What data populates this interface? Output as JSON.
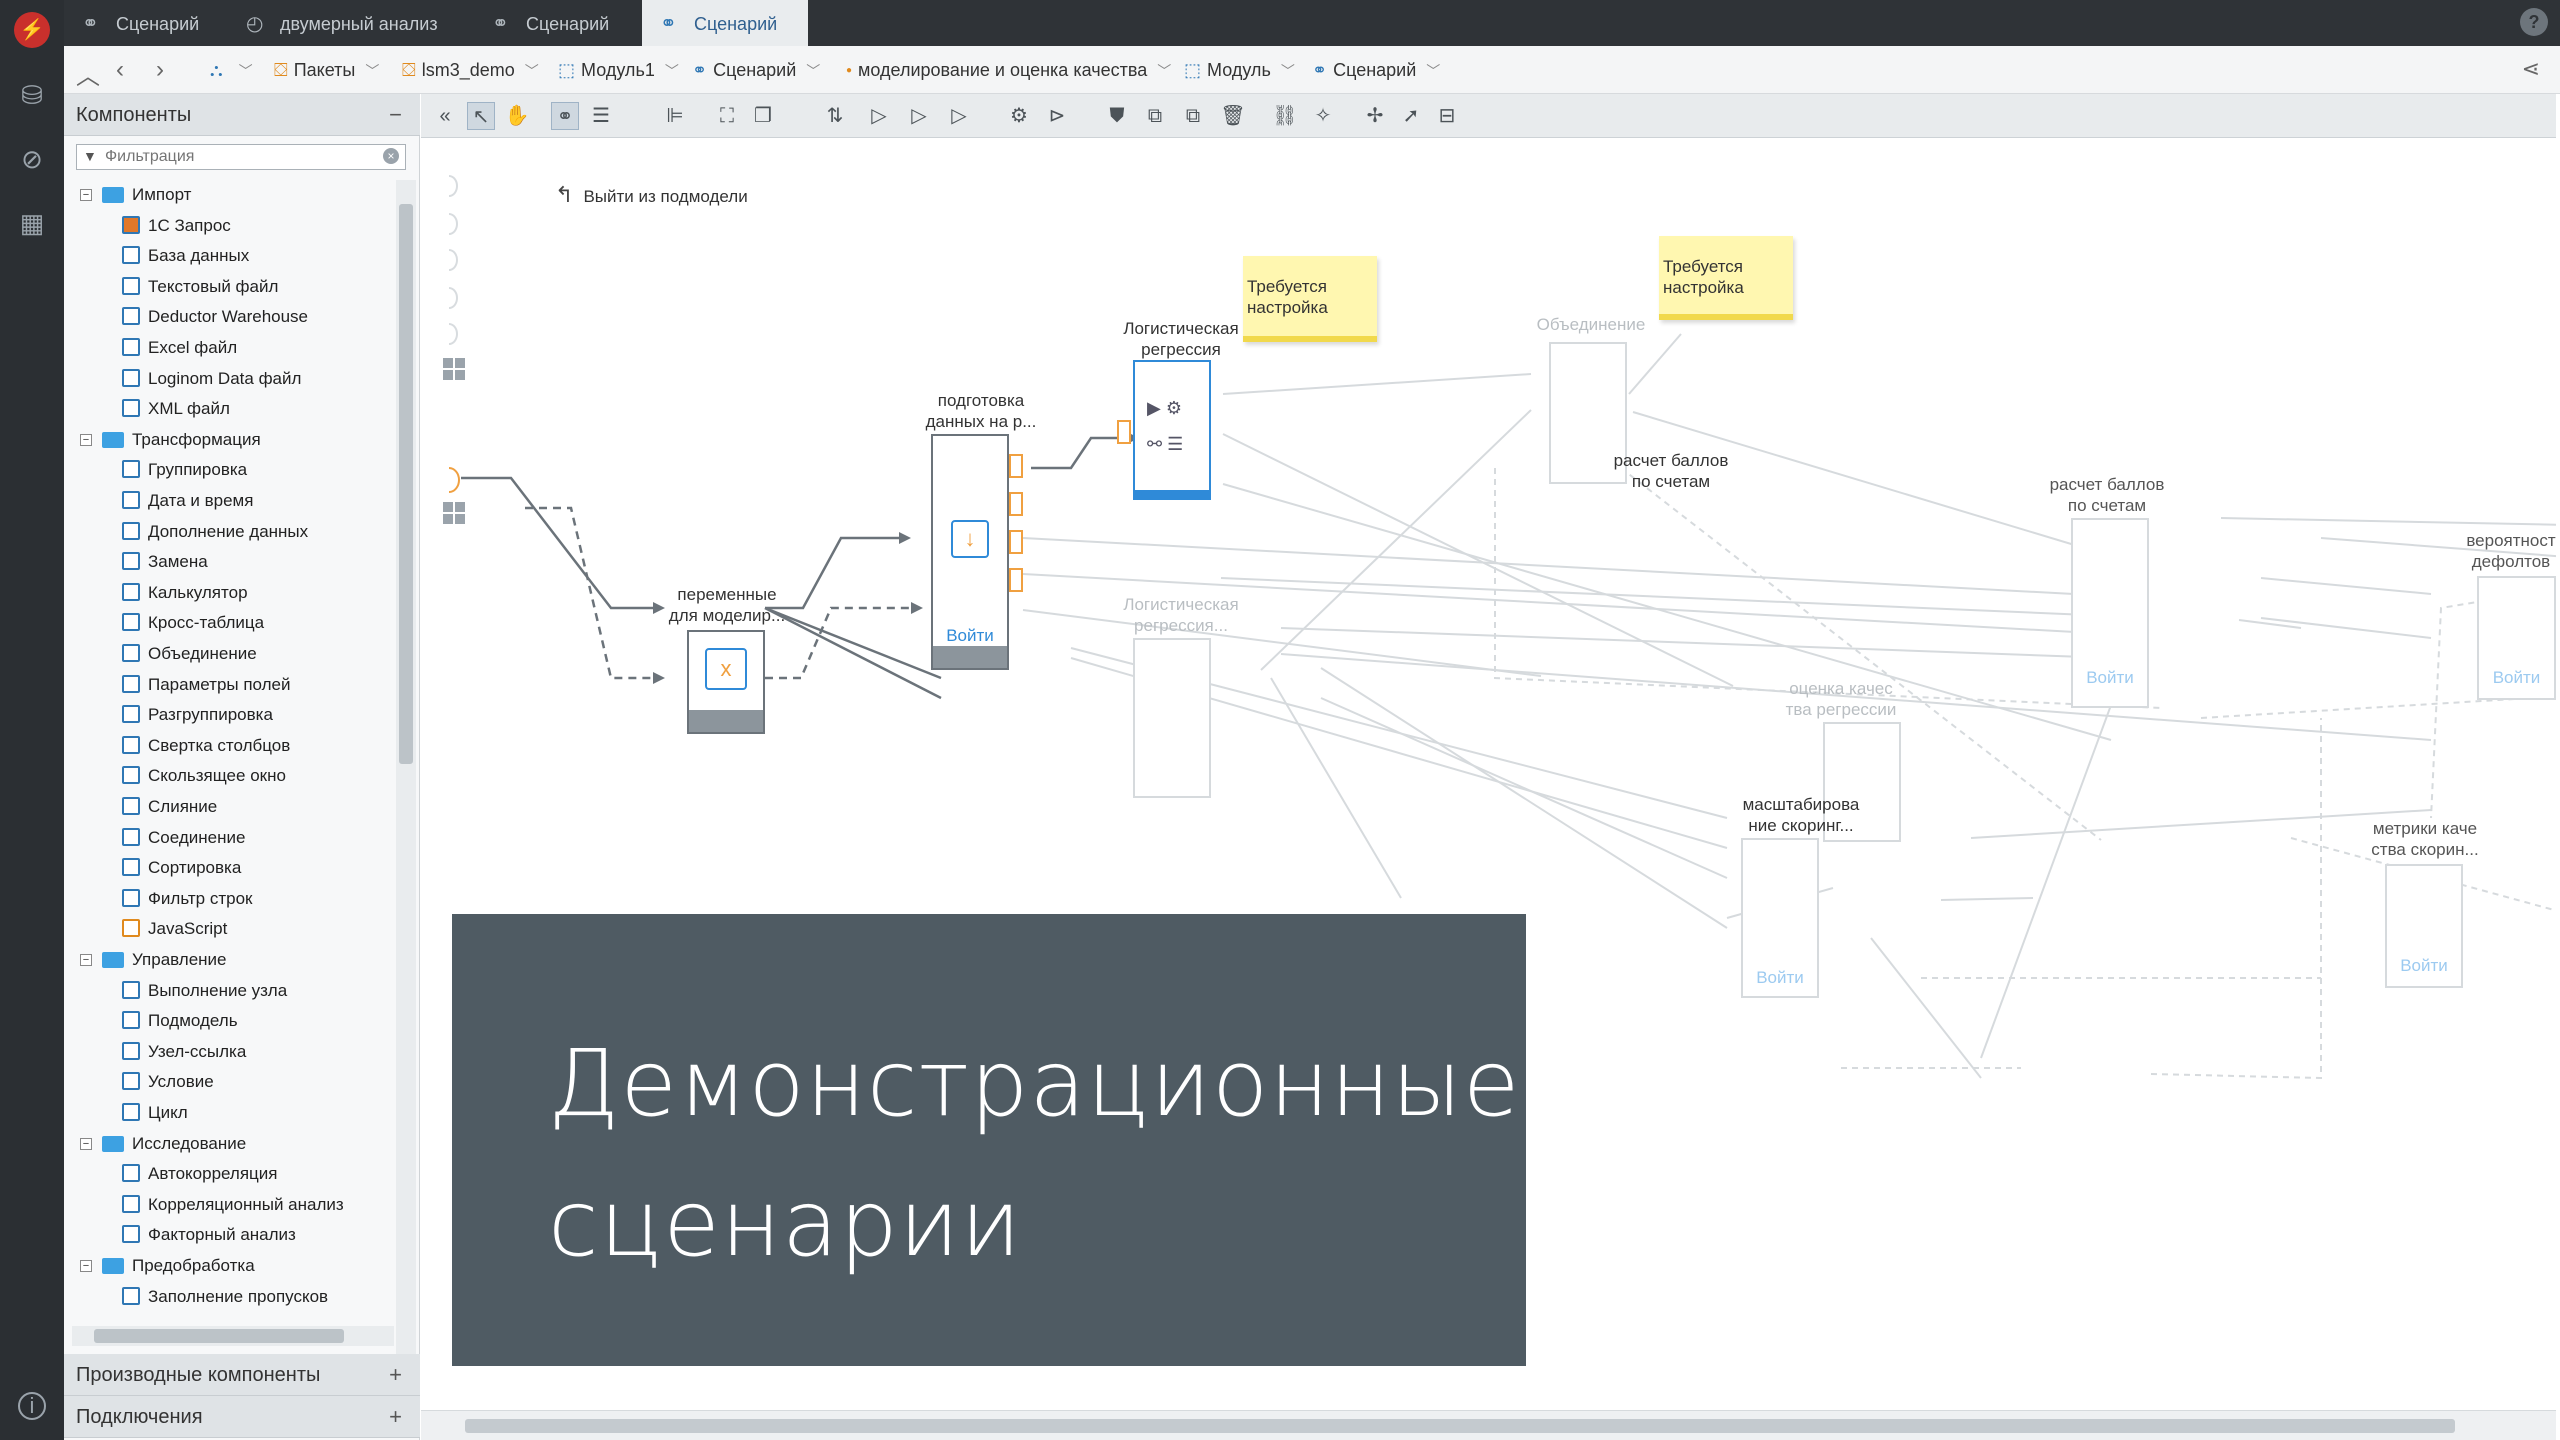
{
  "tabs": [
    {
      "label": "Сценарий",
      "icon": "scenario-icon",
      "active": false
    },
    {
      "label": "двумерный анализ",
      "icon": "model-icon",
      "active": false
    },
    {
      "label": "Сценарий",
      "icon": "scenario-icon",
      "active": false
    },
    {
      "label": "Сценарий",
      "icon": "scenario-icon",
      "active": true
    }
  ],
  "breadcrumbs": [
    {
      "label": "Пакеты",
      "icon": "package-icon"
    },
    {
      "label": "lsm3_demo",
      "icon": "package-icon"
    },
    {
      "label": "Модуль1",
      "icon": "module-icon"
    },
    {
      "label": "Сценарий",
      "icon": "scenario-icon"
    },
    {
      "label": "моделирование и оценка качества",
      "icon": "dot-icon"
    },
    {
      "label": "Модуль",
      "icon": "module-icon"
    },
    {
      "label": "Сценарий",
      "icon": "scenario-icon"
    }
  ],
  "panel": {
    "title": "Компоненты",
    "filter_placeholder": "Фильтрация",
    "groups": [
      {
        "label": "Импорт",
        "items": [
          "1С Запрос",
          "База данных",
          "Текстовый файл",
          "Deductor Warehouse",
          "Excel файл",
          "Loginom Data файл",
          "XML файл"
        ]
      },
      {
        "label": "Трансформация",
        "items": [
          "Группировка",
          "Дата и время",
          "Дополнение данных",
          "Замена",
          "Калькулятор",
          "Кросс-таблица",
          "Объединение",
          "Параметры полей",
          "Разгруппировка",
          "Свертка столбцов",
          "Скользящее окно",
          "Слияние",
          "Соединение",
          "Сортировка",
          "Фильтр строк",
          "JavaScript"
        ]
      },
      {
        "label": "Управление",
        "items": [
          "Выполнение узла",
          "Подмодель",
          "Узел-ссылка",
          "Условие",
          "Цикл"
        ]
      },
      {
        "label": "Исследование",
        "items": [
          "Автокорреляция",
          "Корреляционный анализ",
          "Факторный анализ"
        ]
      },
      {
        "label": "Предобработка",
        "items": [
          "Заполнение пропусков"
        ]
      }
    ],
    "derived_title": "Производные компоненты",
    "connections_title": "Подключения"
  },
  "canvas": {
    "exit_label": "Выйти из подмодели",
    "enter_label": "Войти",
    "nodes": {
      "vars": "переменные\nдля моделир...",
      "prep": "подготовка\nданных на р...",
      "logreg": "Логистическая\nрегрессия",
      "logreg2": "Логистическая\nрегрессия...",
      "merge": "Объединение",
      "quality": "оценка качес\nтва регрессии",
      "scale": "масштабирова\nние скоринг...",
      "scores": "расчет баллов\nпо счетам",
      "metrics": "метрики каче\nства скорин...",
      "prob": "вероятност\nдефолтов"
    },
    "sticky_note": "Требуется\nнастройка"
  },
  "overlay": {
    "title": "Демонстрационные сценарии"
  },
  "colors": {
    "accent": "#2f8ad8",
    "port": "#f0a040",
    "overlay_bg": "#4f5b63",
    "sticky": "#fff7b0"
  }
}
